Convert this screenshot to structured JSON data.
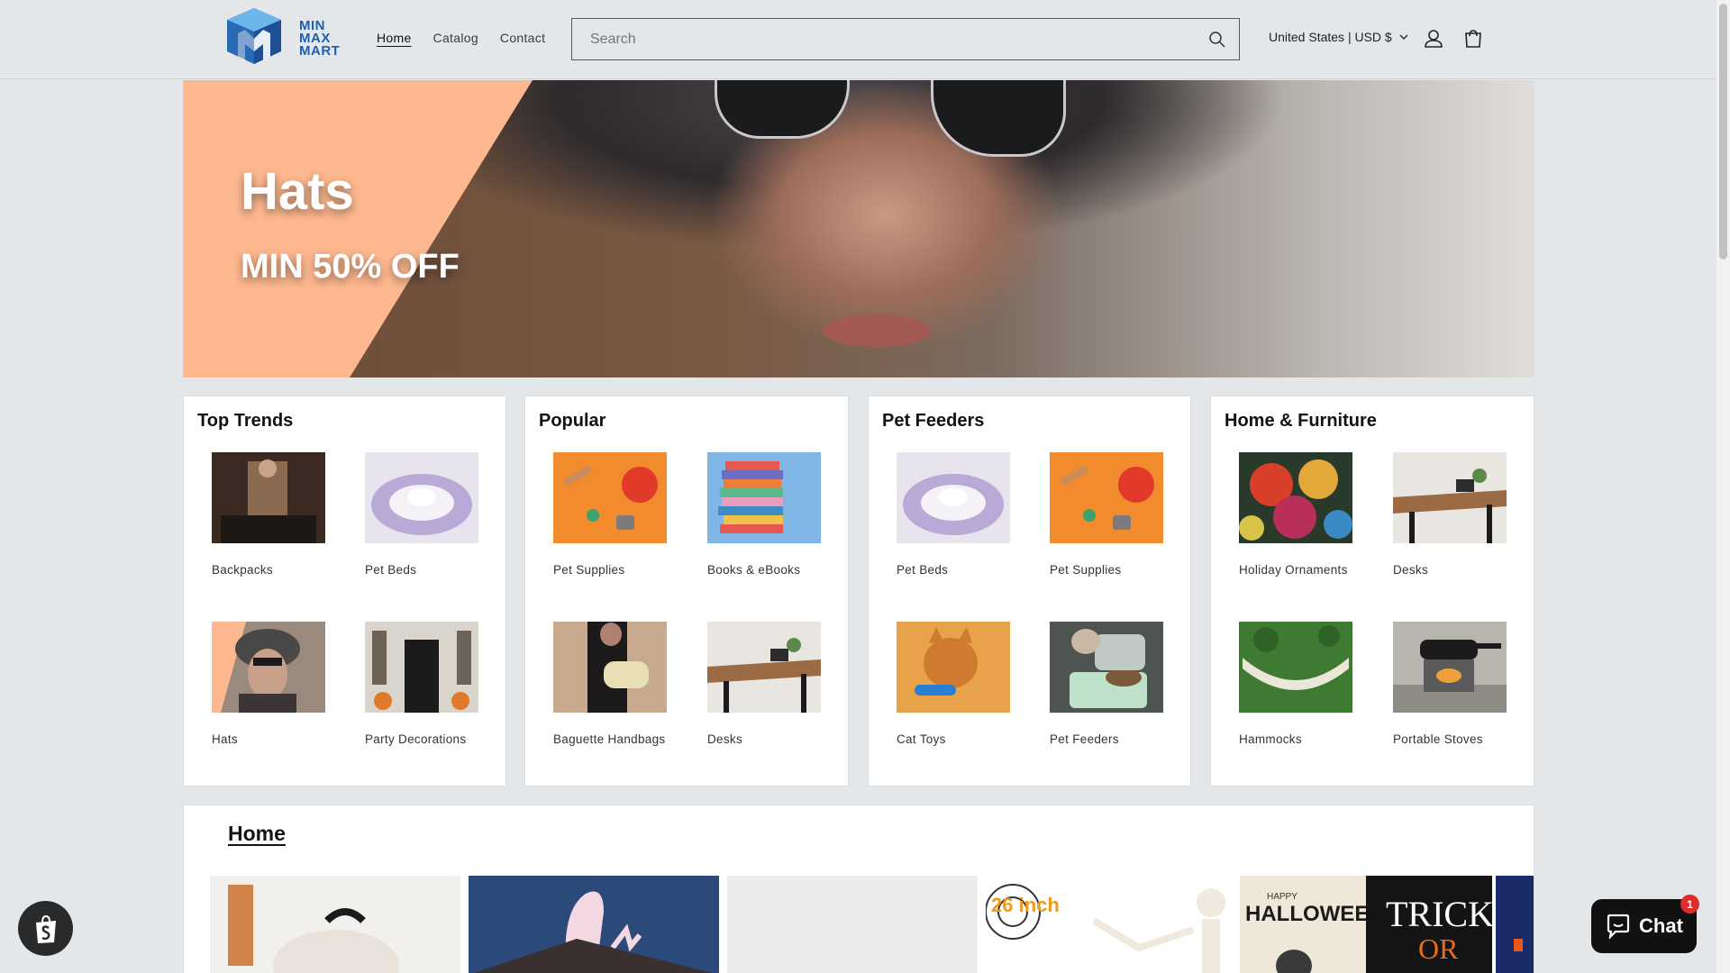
{
  "header": {
    "logo_text": [
      "MIN",
      "MAX",
      "MART"
    ],
    "nav": [
      {
        "label": "Home",
        "active": true
      },
      {
        "label": "Catalog",
        "active": false
      },
      {
        "label": "Contact",
        "active": false
      }
    ],
    "search_placeholder": "Search",
    "locale": "United States | USD $",
    "icons": [
      "search-icon",
      "chevron-down-icon",
      "account-icon",
      "cart-icon"
    ]
  },
  "hero": {
    "title": "Hats",
    "subtitle": "MIN 50% OFF",
    "accent_color": "#fdb88f"
  },
  "cards": [
    {
      "title": "Top Trends",
      "items": [
        {
          "label": "Backpacks",
          "thumb": "backpack-image"
        },
        {
          "label": "Pet Beds",
          "thumb": "pet-bed-image"
        },
        {
          "label": "Hats",
          "thumb": "hat-image"
        },
        {
          "label": "Party Decorations",
          "thumb": "party-decorations-image"
        }
      ]
    },
    {
      "title": "Popular",
      "items": [
        {
          "label": "Pet Supplies",
          "thumb": "pet-supplies-image"
        },
        {
          "label": "Books & eBooks",
          "thumb": "books-image"
        },
        {
          "label": "Baguette Handbags",
          "thumb": "handbag-image"
        },
        {
          "label": "Desks",
          "thumb": "desk-image"
        }
      ]
    },
    {
      "title": "Pet Feeders",
      "items": [
        {
          "label": "Pet Beds",
          "thumb": "pet-bed-image"
        },
        {
          "label": "Pet Supplies",
          "thumb": "pet-supplies-image"
        },
        {
          "label": "Cat Toys",
          "thumb": "cat-toy-image"
        },
        {
          "label": "Pet Feeders",
          "thumb": "pet-feeder-image"
        }
      ]
    },
    {
      "title": "Home & Furniture",
      "items": [
        {
          "label": "Holiday Ornaments",
          "thumb": "ornaments-image"
        },
        {
          "label": "Desks",
          "thumb": "desk-image"
        },
        {
          "label": "Hammocks",
          "thumb": "hammock-image"
        },
        {
          "label": "Portable Stoves",
          "thumb": "stove-image"
        }
      ]
    }
  ],
  "home_section": {
    "title": "Home",
    "product_labels": [
      "26 inch",
      "HAPPY",
      "HALLOWEEN",
      "TRICK",
      "OR"
    ]
  },
  "chat": {
    "label": "Chat",
    "badge": "1"
  },
  "colors": {
    "brand_blue": "#1f5fae",
    "page_bg": "#e3e7e9",
    "hero_band": "#fdb88f"
  }
}
